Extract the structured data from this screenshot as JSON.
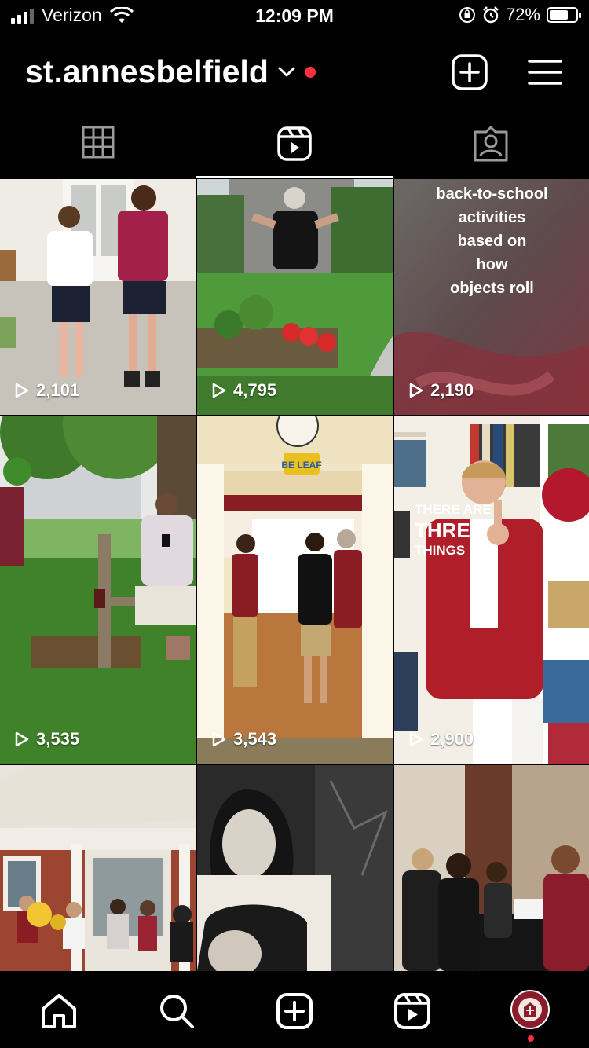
{
  "status_bar": {
    "carrier": "Verizon",
    "time": "12:09 PM",
    "battery": "72%",
    "battery_level": 0.72
  },
  "header": {
    "username": "st.annesbelfield",
    "has_notification": true
  },
  "tabs": [
    {
      "name": "grid",
      "active": false
    },
    {
      "name": "reels",
      "active": true
    },
    {
      "name": "tagged",
      "active": false
    }
  ],
  "reels": [
    {
      "views": "2,101"
    },
    {
      "views": "4,795"
    },
    {
      "views": "2,190",
      "overlay": [
        "back-to-school",
        "activities",
        "based on",
        "how",
        "objects roll"
      ]
    },
    {
      "views": "3,535"
    },
    {
      "views": "3,543",
      "sign": "BE LEAF"
    },
    {
      "views": "2,900",
      "overlay": [
        "THERE ARE",
        "THREE",
        "THINGS FOR"
      ]
    },
    {},
    {},
    {}
  ],
  "bottom_nav": [
    {
      "name": "home-icon"
    },
    {
      "name": "search-icon"
    },
    {
      "name": "create-icon"
    },
    {
      "name": "reels-icon"
    },
    {
      "name": "profile-avatar"
    }
  ],
  "colors": {
    "accent_red": "#ff3040",
    "background": "#000000"
  }
}
